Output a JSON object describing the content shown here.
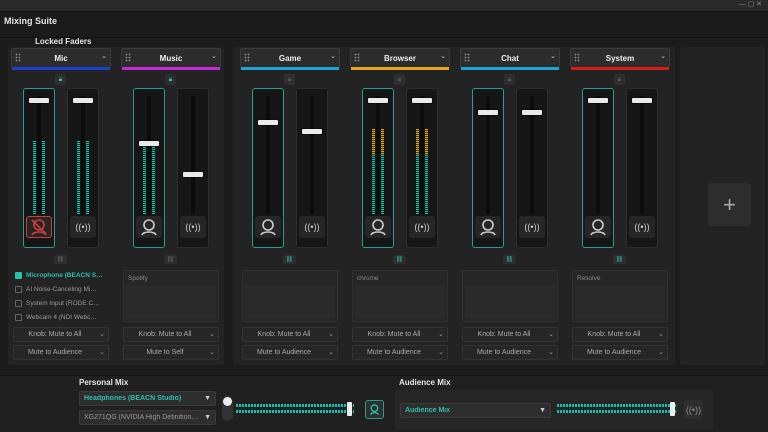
{
  "app": {
    "title": "Mixing Suite",
    "titlebar_controls": "— ▢ ✕"
  },
  "locked_group": {
    "label": "Locked Faders"
  },
  "channels": [
    {
      "name": "Mic",
      "color": "#1f3fd1",
      "src_label": "",
      "kb1": "Knob: Mute to All",
      "kb2": "Mute to Audience",
      "locked": true,
      "local_level": 0.98,
      "stream_level": 0.98,
      "meter1": 0.62,
      "meter2": 0.62,
      "muted": true
    },
    {
      "name": "Music",
      "color": "#c42bd0",
      "src_label": "Spotify",
      "kb1": "Knob: Mute to All",
      "kb2": "Mute to Self",
      "locked": true,
      "local_level": 0.62,
      "stream_level": 0.36,
      "meter1": 0.6,
      "meter2": 0.0
    },
    {
      "name": "Game",
      "color": "#1ea5d6",
      "src_label": "",
      "kb1": "Knob: Mute to All",
      "kb2": "Mute to Audience",
      "locked": false,
      "local_level": 0.8,
      "stream_level": 0.72,
      "meter1": 0,
      "meter2": 0
    },
    {
      "name": "Browser",
      "color": "#e6a51e",
      "src_label": "chrome",
      "kb1": "Knob: Mute to All",
      "kb2": "Mute to Audience",
      "locked": false,
      "local_level": 0.98,
      "stream_level": 0.98,
      "meter1": 0.72,
      "meter2": 0.72
    },
    {
      "name": "Chat",
      "color": "#1ea5d6",
      "src_label": "",
      "kb1": "Knob: Mute to All",
      "kb2": "Mute to Audience",
      "locked": false,
      "local_level": 0.88,
      "stream_level": 0.88,
      "meter1": 0,
      "meter2": 0
    },
    {
      "name": "System",
      "color": "#d41e1e",
      "src_label": "Resolve",
      "kb1": "Knob: Mute to All",
      "kb2": "Mute to Audience",
      "locked": false,
      "local_level": 0.98,
      "stream_level": 0.98,
      "meter1": 0,
      "meter2": 0
    }
  ],
  "mic_devices": [
    {
      "label": "Microphone (BEACN S…",
      "checked": true
    },
    {
      "label": "AI Noise-Canceling Mi…",
      "checked": false
    },
    {
      "label": "System Input (RODE C…",
      "checked": false
    },
    {
      "label": "Webcam 4 (NDI Webc…",
      "checked": false
    }
  ],
  "add_button": {
    "label": "+"
  },
  "personal_mix": {
    "label": "Personal Mix",
    "device1": "Headphones (BEACN Studio)",
    "device2": "XG271QG (NVIDIA High Definition…",
    "level": 0.95
  },
  "audience_mix": {
    "label": "Audience Mix",
    "device": "Audience Mix",
    "level": 0.95
  },
  "colors": {
    "accent": "#2bbfae",
    "mic_muted": "#d63a3a"
  }
}
